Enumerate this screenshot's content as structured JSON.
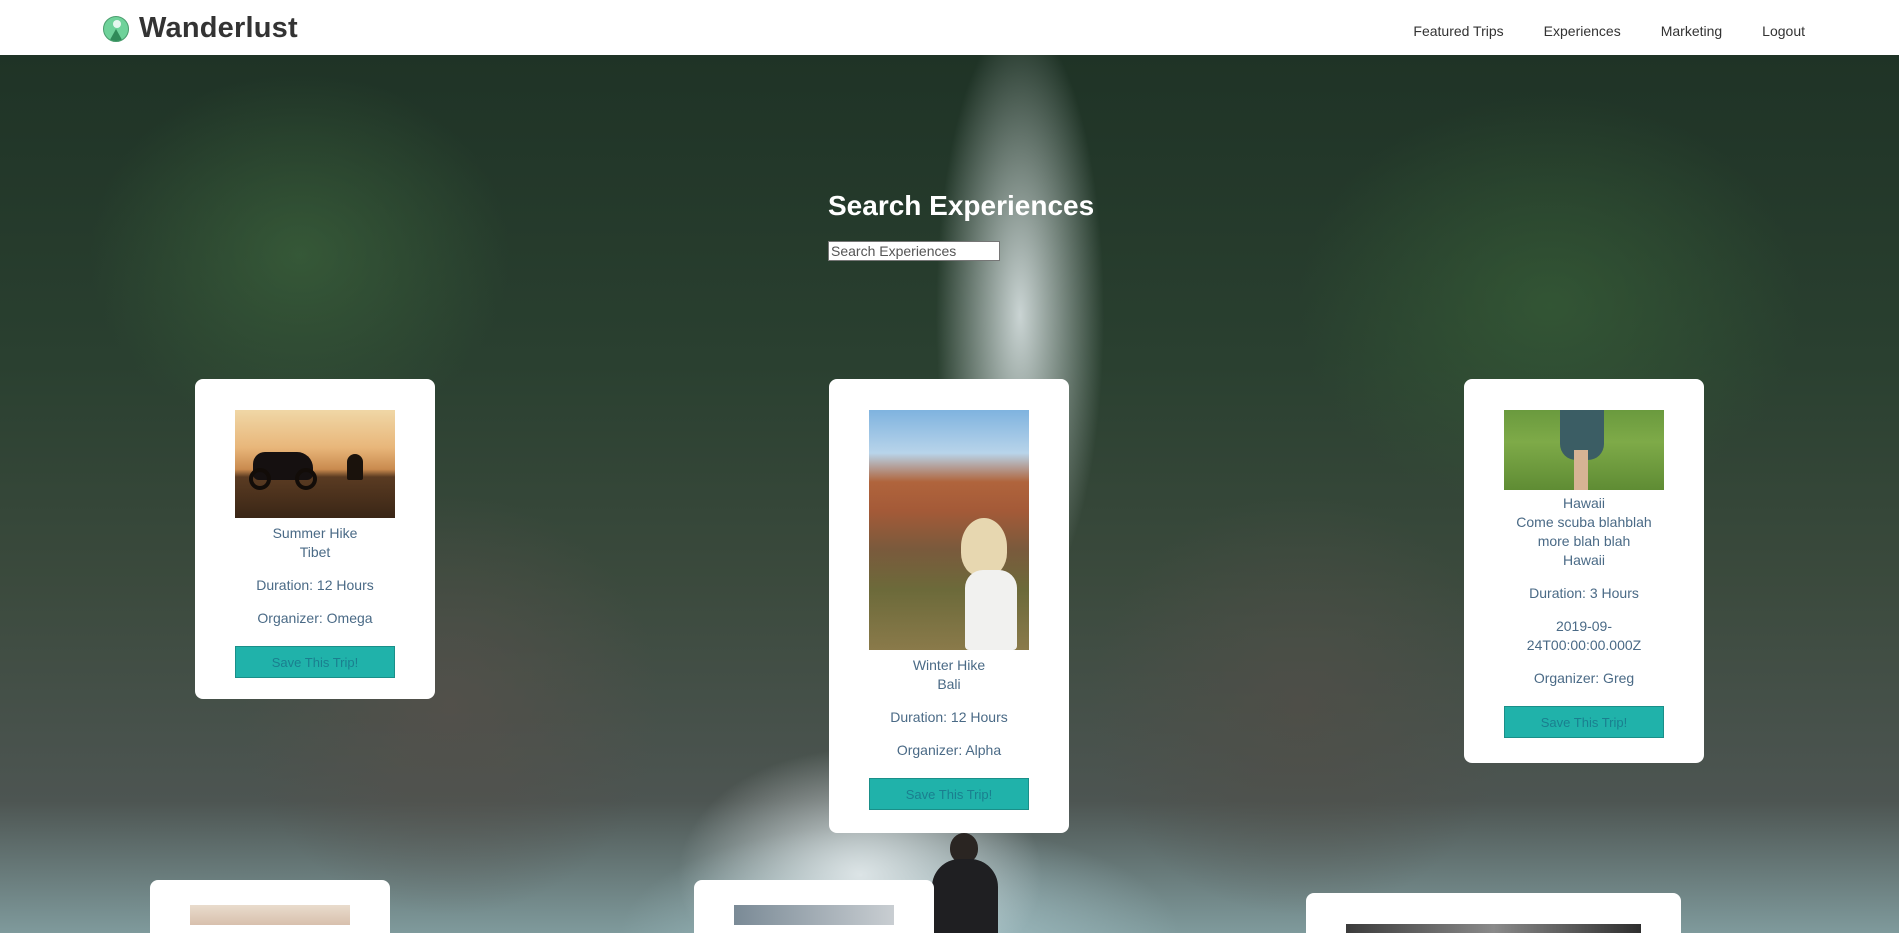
{
  "nav": {
    "brand": "Wanderlust",
    "links": [
      "Featured Trips",
      "Experiences",
      "Marketing",
      "Logout"
    ]
  },
  "search": {
    "title": "Search Experiences",
    "placeholder": "Search Experiences"
  },
  "cards": [
    {
      "title": "Summer Hike",
      "location": "Tibet",
      "duration": "Duration: 12 Hours",
      "organizer": "Organizer: Omega",
      "button": "Save This Trip!",
      "image": "motorcycle-sunset-image"
    },
    {
      "title": "Winter Hike",
      "location": "Bali",
      "duration": "Duration: 12 Hours",
      "organizer": "Organizer: Alpha",
      "button": "Save This Trip!",
      "image": "woman-canyon-image"
    },
    {
      "title": "Hawaii",
      "description": "Come scuba blahblah more blah blah",
      "location": "Hawaii",
      "duration": "Duration: 3 Hours",
      "date": "2019-09-24T00:00:00.000Z",
      "organizer": "Organizer: Greg",
      "button": "Save This Trip!",
      "image": "grass-walk-image"
    }
  ],
  "colors": {
    "button_bg": "#20b2aa",
    "card_text": "#4a6a86",
    "nav_text": "#333333"
  }
}
